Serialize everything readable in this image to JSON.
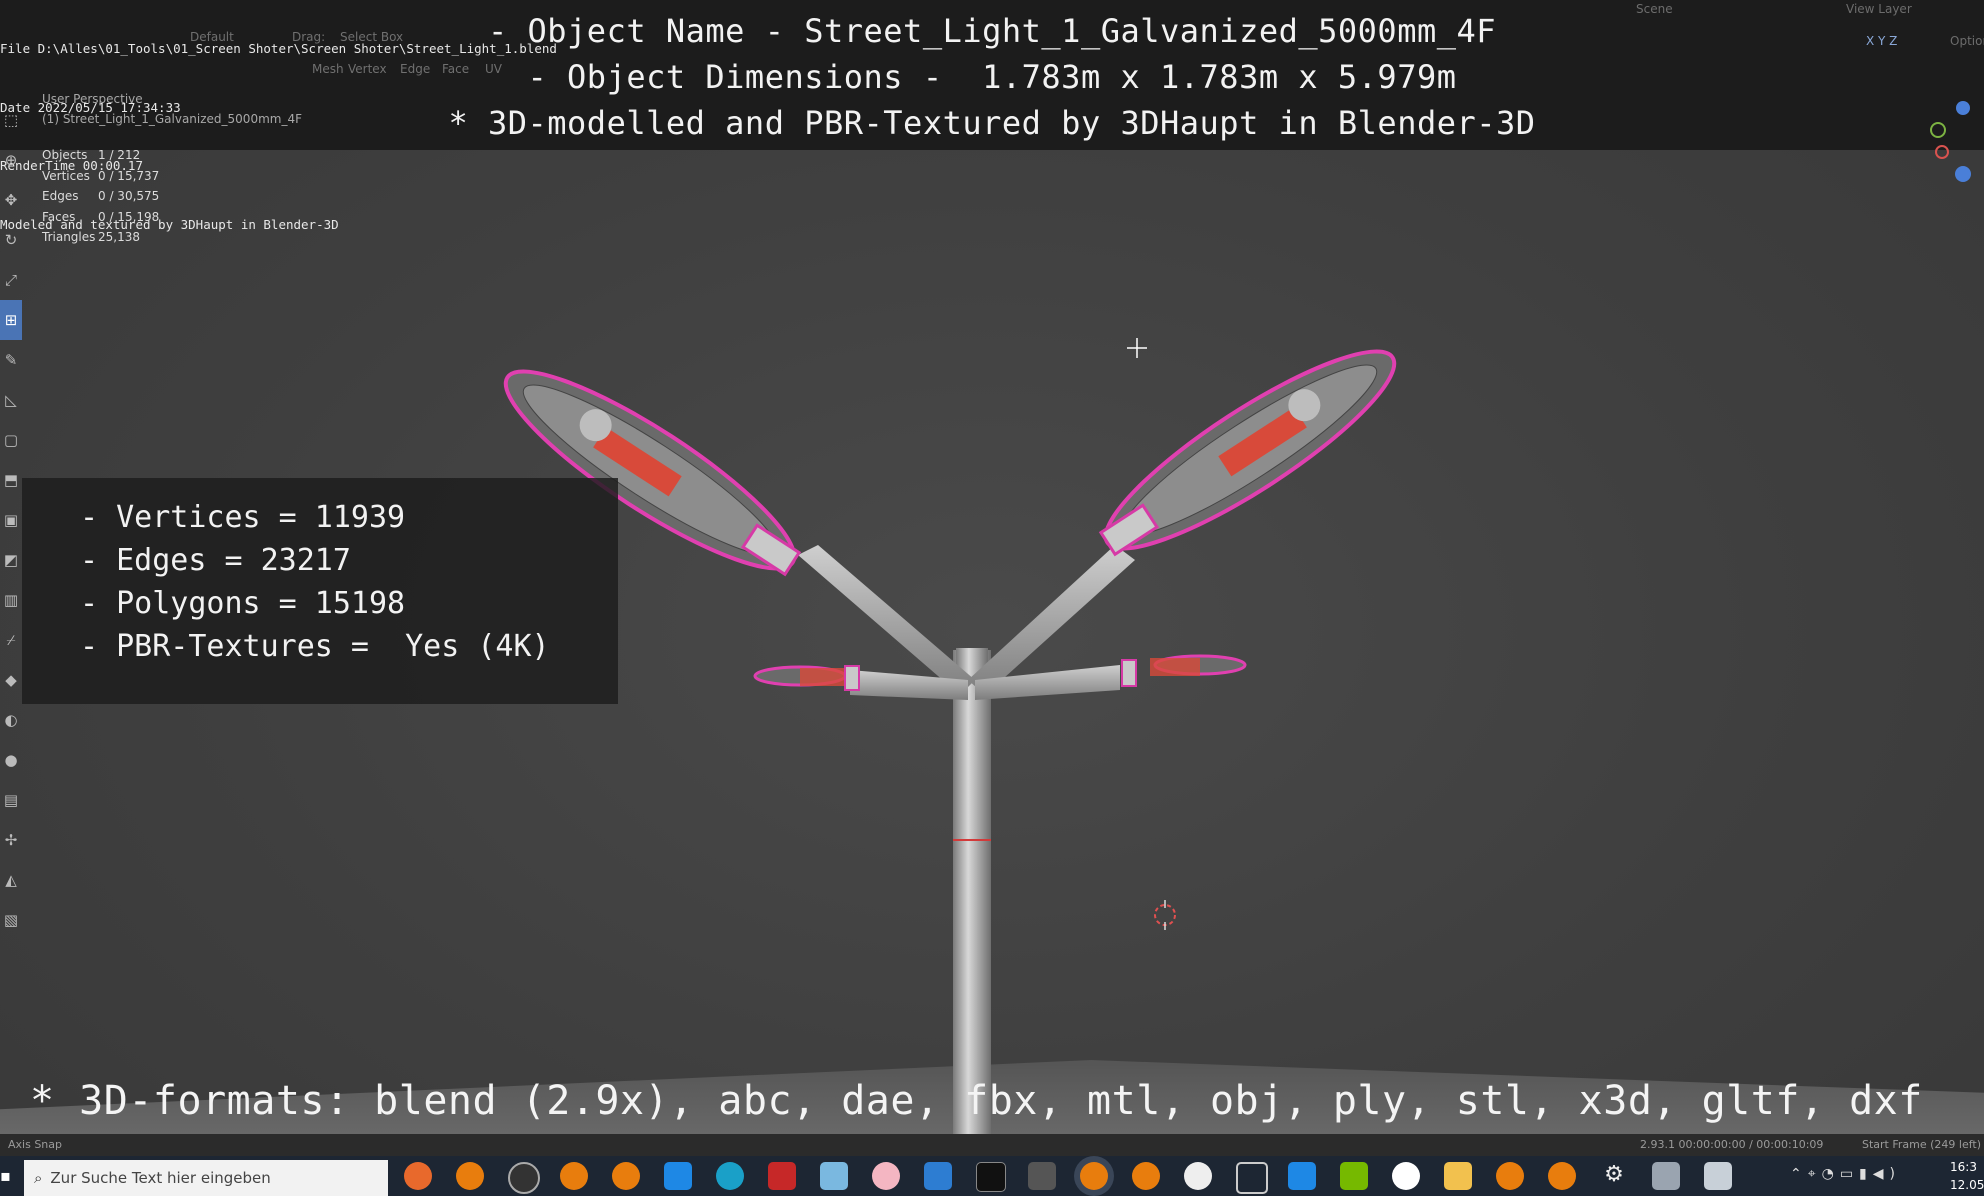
{
  "render_info": {
    "file": "File D:\\Alles\\01_Tools\\01_Screen Shoter\\Screen Shoter\\Street_Light_1.blend",
    "date": "Date 2022/05/15 17:34:33",
    "render_time": "RenderTime 00:00.17",
    "credit": "Modeled and textured by 3DHaupt in Blender-3D"
  },
  "title": {
    "object_name": "- Object Name - Street_Light_1_Galvanized_5000mm_4F",
    "dimensions": "- Object Dimensions -  1.783m x 1.783m x 5.979m",
    "credit": "* 3D-modelled and PBR-Textured by 3DHaupt in Blender-3D"
  },
  "header_ghost": {
    "orientation": "Default",
    "drag_label": "Drag:",
    "drag_value": "Select Box",
    "mesh": "Mesh",
    "vertex": "Vertex",
    "edge": "Edge",
    "face": "Face",
    "uv": "UV",
    "scene": "Scene",
    "view_layer": "View Layer",
    "options": "Option",
    "axes": "X Y Z"
  },
  "viewport": {
    "perspective": "User Perspective",
    "object": "(1) Street_Light_1_Galvanized_5000mm_4F"
  },
  "stats": [
    {
      "label": "Objects",
      "value": "1 / 212"
    },
    {
      "label": "Vertices",
      "value": "0 / 15,737"
    },
    {
      "label": "Edges",
      "value": "0 / 30,575"
    },
    {
      "label": "Faces",
      "value": "0 / 15,198"
    },
    {
      "label": "Triangles",
      "value": "25,138"
    }
  ],
  "specs": {
    "vertices": "- Vertices = 11939",
    "edges": "- Edges = 23217",
    "polygons": "- Polygons = 15198",
    "textures": "- PBR-Textures =  Yes (4K)"
  },
  "formats": "* 3D-formats: blend (2.9x), abc, dae, fbx, mtl, obj, ply, stl, x3d, gltf, dxf",
  "statusbar": {
    "left": "Axis Snap",
    "version": "2.93.1  00:00:00:00 / 00:00:10:09",
    "frame": "Start Frame (249 left)"
  },
  "taskbar": {
    "search_placeholder": "Zur Suche Text hier eingeben",
    "time": "16:3",
    "date": "12.05"
  },
  "colors": {
    "viewport_bg": "#3f3f3f",
    "overlay_bg": "#181818",
    "selection_outline": "#d63aa6",
    "active_tool": "#4a74b5",
    "taskbar_bg": "#1d2633"
  },
  "toolbar_icons": [
    "select-box-icon",
    "cursor-icon",
    "move-icon",
    "rotate-icon",
    "scale-icon",
    "transform-icon",
    "annotate-icon",
    "measure-icon",
    "add-cube-icon",
    "extrude-icon",
    "inset-icon",
    "bevel-icon",
    "loop-cut-icon",
    "knife-icon",
    "poly-build-icon",
    "spin-icon",
    "smooth-icon",
    "edge-slide-icon",
    "shrink-icon",
    "shear-icon",
    "rip-icon"
  ],
  "taskbar_icons": [
    "firefox-icon",
    "blender-icon",
    "obs-icon",
    "blender-icon",
    "blender-icon",
    "mail-icon",
    "edge-icon",
    "bug-icon",
    "notes-icon",
    "brain-icon",
    "store-icon",
    "terminal-icon",
    "cat-icon",
    "blender-icon",
    "blender-icon",
    "panda-icon",
    "cube-icon",
    "calendar-icon",
    "nvidia-icon",
    "app-icon",
    "folder-icon",
    "blender-icon",
    "blender-icon",
    "settings-icon",
    "printer-icon",
    "monitor-icon"
  ]
}
